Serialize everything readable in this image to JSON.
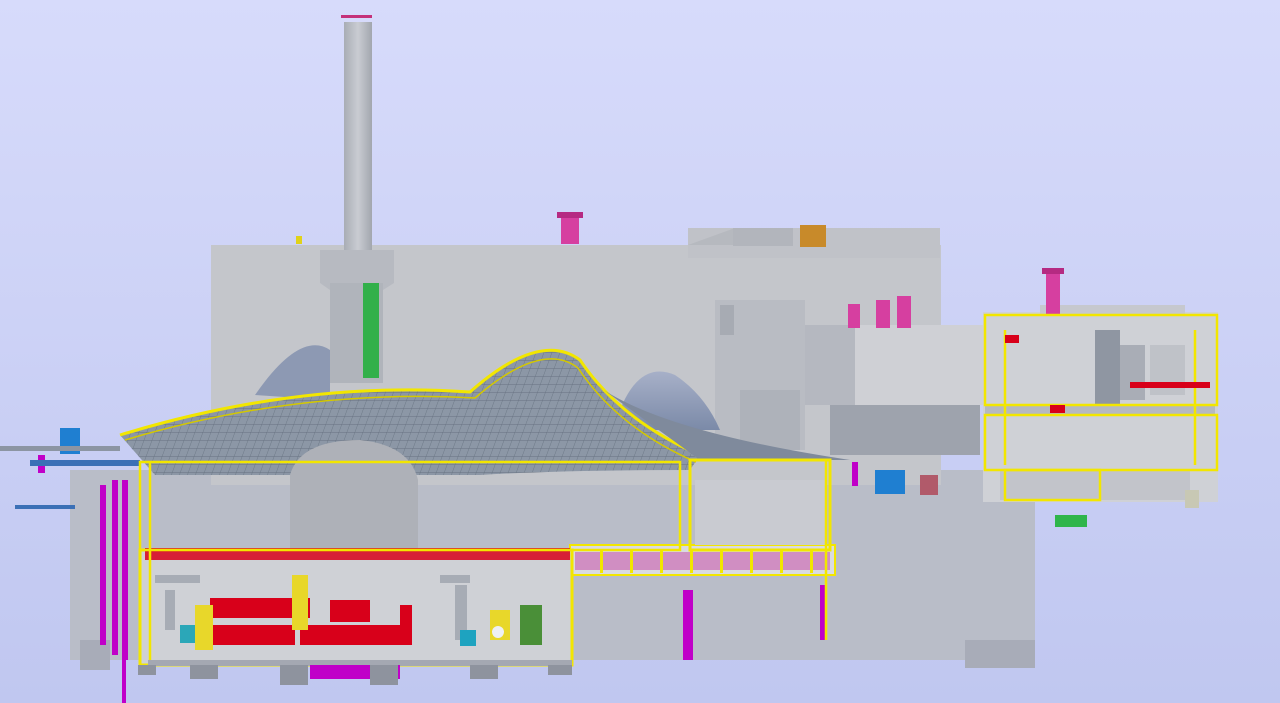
{
  "viewport": {
    "background_top": "#d7dbfb",
    "background_bottom": "#c0c7f0"
  },
  "colors": {
    "structure_light": "#c8cacf",
    "structure_mid": "#b5b8c0",
    "structure_dark": "#9ea3ad",
    "roof_mesh": "#7a8594",
    "frame_yellow": "#f2e600",
    "equipment_red": "#d8001a",
    "equipment_magenta": "#c000c8",
    "vent_pink": "#d63fa0",
    "pipe_blue": "#1f7fd1",
    "pipe_green": "#2fb54a",
    "pipe_cyan": "#22c4d8",
    "pipe_orange": "#c88a2a",
    "ground": "#b9bdc8"
  },
  "model": {
    "name": "plant-cutaway-3d-model",
    "parts": [
      "chimney-stack",
      "main-hall-block",
      "tensile-roof",
      "basement-equipment-room",
      "corridor-gallery",
      "east-annex",
      "rooftop-vents",
      "support-columns"
    ]
  }
}
